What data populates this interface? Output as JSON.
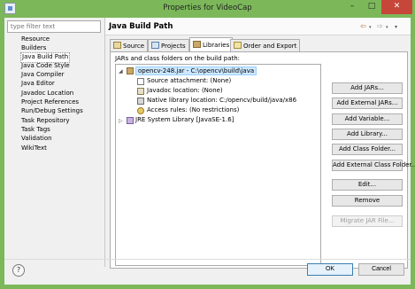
{
  "window": {
    "title": "Properties for VideoCap",
    "minimize_glyph": "–",
    "maximize_glyph": "□",
    "close_glyph": "✕"
  },
  "filter": {
    "placeholder": "type filter text"
  },
  "nav": {
    "items": [
      {
        "label": "Resource"
      },
      {
        "label": "Builders"
      },
      {
        "label": "Java Build Path",
        "selected": true
      },
      {
        "label": "Java Code Style"
      },
      {
        "label": "Java Compiler"
      },
      {
        "label": "Java Editor"
      },
      {
        "label": "Javadoc Location"
      },
      {
        "label": "Project References"
      },
      {
        "label": "Run/Debug Settings"
      },
      {
        "label": "Task Repository"
      },
      {
        "label": "Task Tags"
      },
      {
        "label": "Validation"
      },
      {
        "label": "WikiText"
      }
    ]
  },
  "header": {
    "title": "Java Build Path",
    "back_glyph": "⇦",
    "forward_glyph": "⇨",
    "dropdown_glyph": "▾"
  },
  "tabs": [
    {
      "label": "Source"
    },
    {
      "label": "Projects"
    },
    {
      "label": "Libraries",
      "active": true
    },
    {
      "label": "Order and Export"
    }
  ],
  "panel": {
    "label": "JARs and class folders on the build path:",
    "tree": {
      "jar": {
        "label": "opencv-248.jar - C:\\opencv\\build\\java",
        "expanded": true
      },
      "jar_children": [
        {
          "label": "Source attachment: (None)",
          "icon": "source-icon"
        },
        {
          "label": "Javadoc location: (None)",
          "icon": "javadoc-icon"
        },
        {
          "label": "Native library location: C:/opencv/build/java/x86",
          "icon": "native-library-icon"
        },
        {
          "label": "Access rules: (No restrictions)",
          "icon": "access-rules-icon"
        }
      ],
      "jre": {
        "label": "JRE System Library [JavaSE-1.6]",
        "expanded": false
      }
    },
    "buttons": [
      {
        "label": "Add JARs...",
        "enabled": true
      },
      {
        "label": "Add External JARs...",
        "enabled": true
      },
      {
        "label": "Add Variable...",
        "enabled": true
      },
      {
        "label": "Add Library...",
        "enabled": true
      },
      {
        "label": "Add Class Folder...",
        "enabled": true
      },
      {
        "label": "Add External Class Folder...",
        "enabled": true
      },
      {
        "label": "Edit...",
        "enabled": true
      },
      {
        "label": "Remove",
        "enabled": true
      },
      {
        "label": "Migrate JAR File...",
        "enabled": false
      }
    ]
  },
  "footer": {
    "help_glyph": "?",
    "ok_label": "OK",
    "cancel_label": "Cancel"
  }
}
